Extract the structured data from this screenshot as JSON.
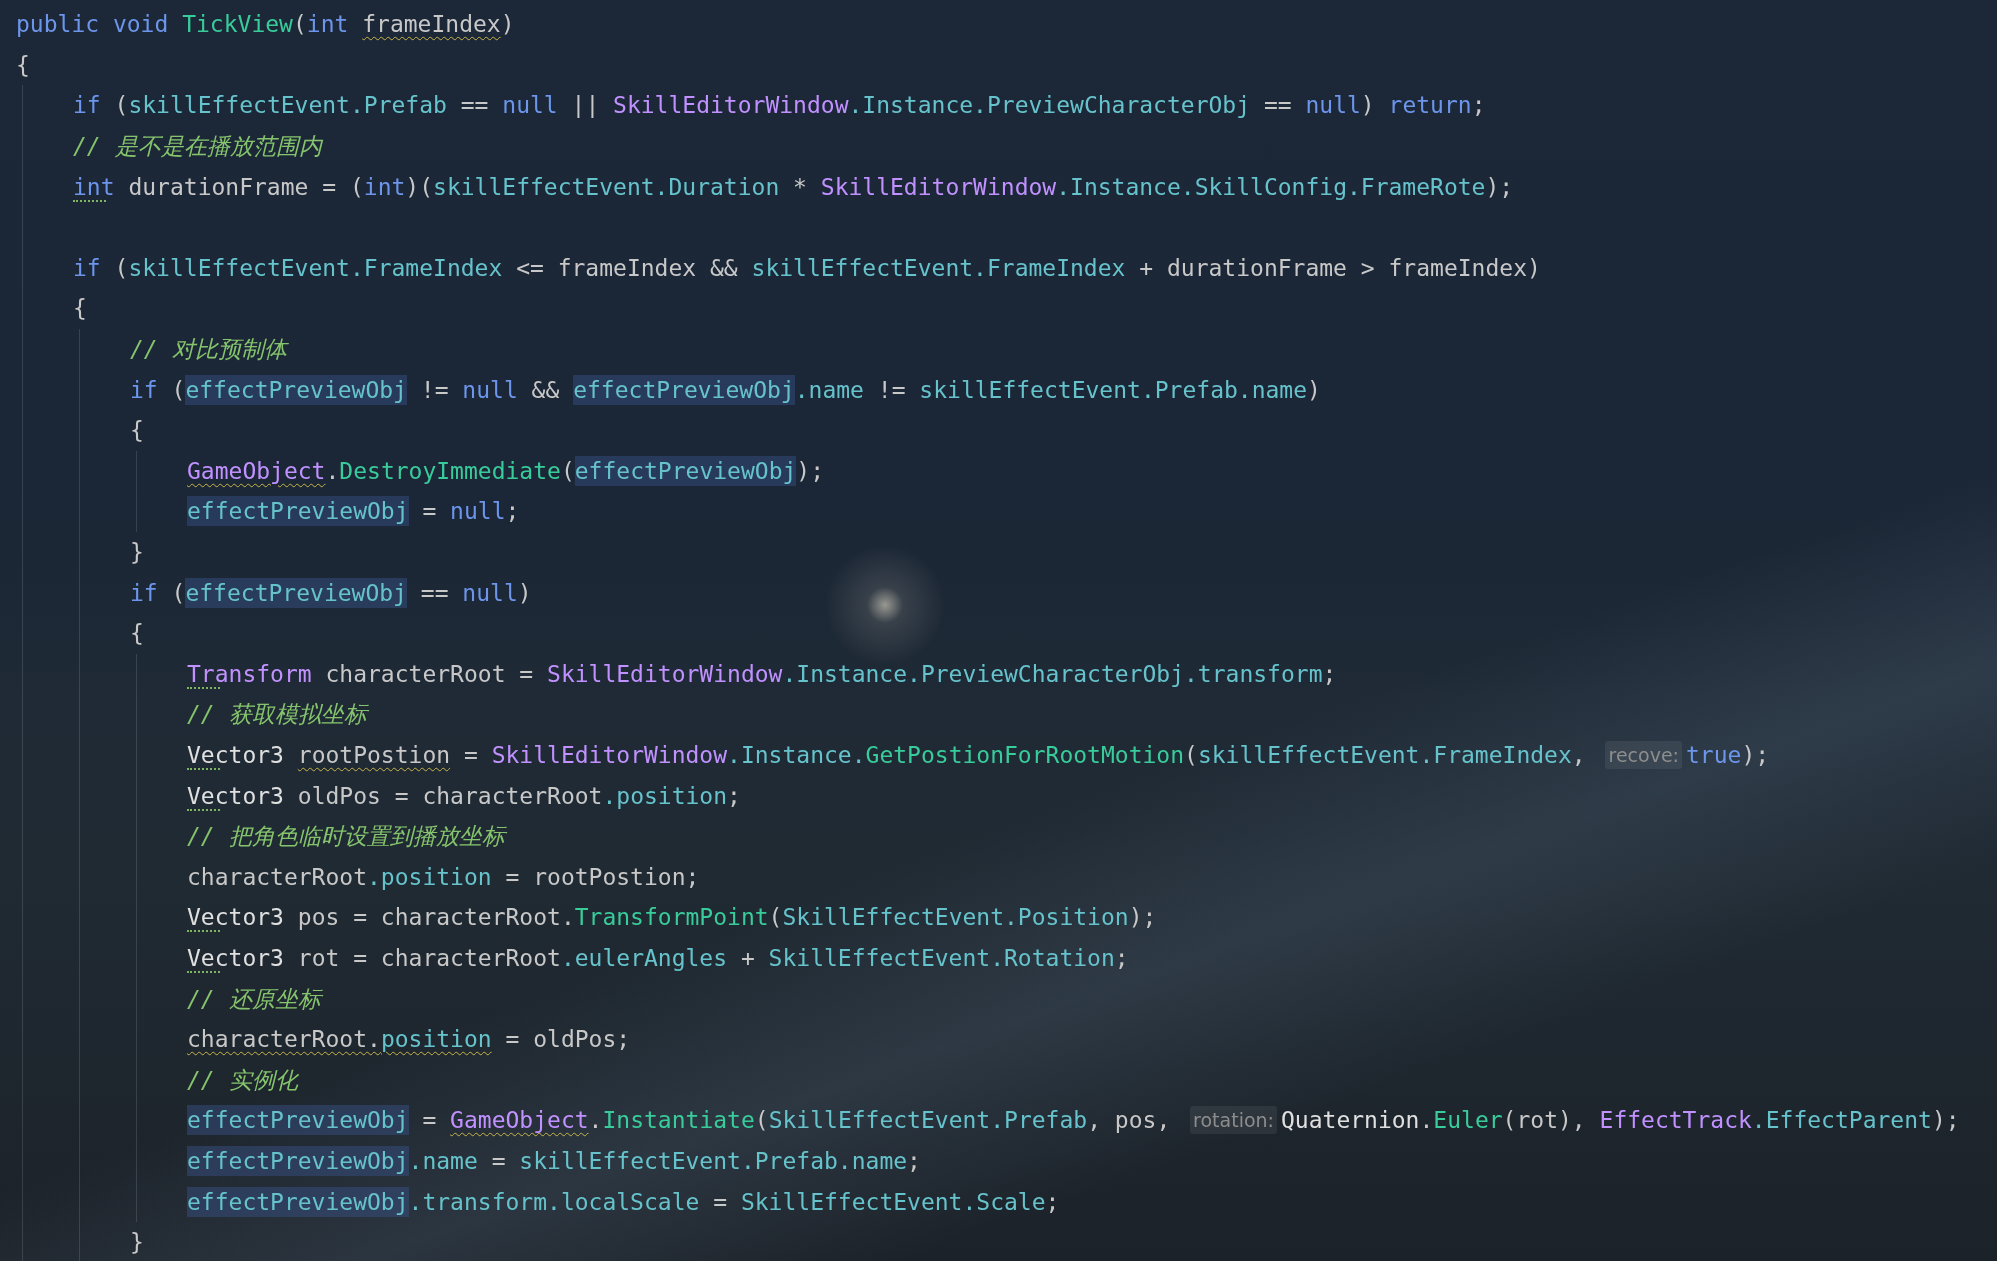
{
  "editor": {
    "lines": [
      {
        "tokens": [
          {
            "text": "public void ",
            "kind": "keyword",
            "wavy": false,
            "dotted": false,
            "highlighted": false
          },
          {
            "text": "TickView",
            "kind": "method",
            "wavy": false,
            "dotted": false,
            "highlighted": false
          },
          {
            "text": "(",
            "kind": "plain",
            "wavy": false,
            "dotted": false,
            "highlighted": false
          },
          {
            "text": "int ",
            "kind": "keyword",
            "wavy": false,
            "dotted": false,
            "highlighted": false
          },
          {
            "text": "frameIndex",
            "kind": "plain",
            "wavy": true,
            "dotted": false,
            "highlighted": false
          },
          {
            "text": ")",
            "kind": "plain",
            "wavy": false,
            "dotted": false,
            "highlighted": false
          }
        ]
      },
      {
        "tokens": [
          {
            "text": "{",
            "kind": "plain",
            "wavy": false,
            "dotted": false,
            "highlighted": false
          }
        ],
        "children": [
          {
            "tokens": [
              {
                "text": "if",
                "kind": "keyword",
                "wavy": false,
                "dotted": false,
                "highlighted": false
              },
              {
                "text": " (",
                "kind": "plain",
                "wavy": false,
                "dotted": false,
                "highlighted": false
              },
              {
                "text": "skillEffectEvent.Prefab",
                "kind": "member",
                "wavy": false,
                "dotted": false,
                "highlighted": false
              },
              {
                "text": " == ",
                "kind": "plain",
                "wavy": false,
                "dotted": false,
                "highlighted": false
              },
              {
                "text": "null",
                "kind": "keyword",
                "wavy": false,
                "dotted": false,
                "highlighted": false
              },
              {
                "text": " || ",
                "kind": "plain",
                "wavy": false,
                "dotted": false,
                "highlighted": false
              },
              {
                "text": "SkillEditorWindow",
                "kind": "class",
                "wavy": false,
                "dotted": false,
                "highlighted": false
              },
              {
                "text": ".Instance.PreviewCharacterObj",
                "kind": "member",
                "wavy": false,
                "dotted": false,
                "highlighted": false
              },
              {
                "text": " == ",
                "kind": "plain",
                "wavy": false,
                "dotted": false,
                "highlighted": false
              },
              {
                "text": "null",
                "kind": "keyword",
                "wavy": false,
                "dotted": false,
                "highlighted": false
              },
              {
                "text": ") ",
                "kind": "plain",
                "wavy": false,
                "dotted": false,
                "highlighted": false
              },
              {
                "text": "return",
                "kind": "keyword",
                "wavy": false,
                "dotted": false,
                "highlighted": false
              },
              {
                "text": ";",
                "kind": "plain",
                "wavy": false,
                "dotted": false,
                "highlighted": false
              }
            ]
          },
          {
            "tokens": [
              {
                "text": "// 是不是在播放范围内",
                "kind": "comment",
                "wavy": false,
                "dotted": false,
                "highlighted": false
              }
            ]
          },
          {
            "tokens": [
              {
                "text": "int",
                "kind": "keyword",
                "wavy": false,
                "dotted": true,
                "highlighted": false
              },
              {
                "text": " durationFrame = (",
                "kind": "plain",
                "wavy": false,
                "dotted": false,
                "highlighted": false
              },
              {
                "text": "int",
                "kind": "keyword",
                "wavy": false,
                "dotted": false,
                "highlighted": false
              },
              {
                "text": ")(",
                "kind": "plain",
                "wavy": false,
                "dotted": false,
                "highlighted": false
              },
              {
                "text": "skillEffectEvent.Duration",
                "kind": "member",
                "wavy": false,
                "dotted": false,
                "highlighted": false
              },
              {
                "text": " * ",
                "kind": "plain",
                "wavy": false,
                "dotted": false,
                "highlighted": false
              },
              {
                "text": "SkillEditorWindow",
                "kind": "class",
                "wavy": false,
                "dotted": false,
                "highlighted": false
              },
              {
                "text": ".Instance.SkillConfig.FrameRote",
                "kind": "member",
                "wavy": false,
                "dotted": false,
                "highlighted": false
              },
              {
                "text": ");",
                "kind": "plain",
                "wavy": false,
                "dotted": false,
                "highlighted": false
              }
            ]
          },
          {
            "blank": true
          },
          {
            "tokens": [
              {
                "text": "if",
                "kind": "keyword",
                "wavy": false,
                "dotted": false,
                "highlighted": false
              },
              {
                "text": " (",
                "kind": "plain",
                "wavy": false,
                "dotted": false,
                "highlighted": false
              },
              {
                "text": "skillEffectEvent.FrameIndex",
                "kind": "member",
                "wavy": false,
                "dotted": false,
                "highlighted": false
              },
              {
                "text": " <= frameIndex && ",
                "kind": "plain",
                "wavy": false,
                "dotted": false,
                "highlighted": false
              },
              {
                "text": "skillEffectEvent.FrameIndex",
                "kind": "member",
                "wavy": false,
                "dotted": false,
                "highlighted": false
              },
              {
                "text": " + durationFrame > frameIndex)",
                "kind": "plain",
                "wavy": false,
                "dotted": false,
                "highlighted": false
              }
            ]
          },
          {
            "tokens": [
              {
                "text": "{",
                "kind": "plain",
                "wavy": false,
                "dotted": false,
                "highlighted": false
              }
            ],
            "children": [
              {
                "tokens": [
                  {
                    "text": "// 对比预制体",
                    "kind": "comment",
                    "wavy": false,
                    "dotted": false,
                    "highlighted": false
                  }
                ]
              },
              {
                "tokens": [
                  {
                    "text": "if",
                    "kind": "keyword",
                    "wavy": false,
                    "dotted": false,
                    "highlighted": false
                  },
                  {
                    "text": " (",
                    "kind": "plain",
                    "wavy": false,
                    "dotted": false,
                    "highlighted": false
                  },
                  {
                    "text": "effectPreviewObj",
                    "kind": "member",
                    "wavy": false,
                    "dotted": false,
                    "highlighted": true
                  },
                  {
                    "text": " != ",
                    "kind": "plain",
                    "wavy": false,
                    "dotted": false,
                    "highlighted": false
                  },
                  {
                    "text": "null",
                    "kind": "keyword",
                    "wavy": false,
                    "dotted": false,
                    "highlighted": false
                  },
                  {
                    "text": " && ",
                    "kind": "plain",
                    "wavy": false,
                    "dotted": false,
                    "highlighted": false
                  },
                  {
                    "text": "effectPreviewObj",
                    "kind": "member",
                    "wavy": false,
                    "dotted": false,
                    "highlighted": true
                  },
                  {
                    "text": ".name",
                    "kind": "member",
                    "wavy": false,
                    "dotted": false,
                    "highlighted": false
                  },
                  {
                    "text": " != ",
                    "kind": "plain",
                    "wavy": false,
                    "dotted": false,
                    "highlighted": false
                  },
                  {
                    "text": "skillEffectEvent.Prefab.name",
                    "kind": "member",
                    "wavy": false,
                    "dotted": false,
                    "highlighted": false
                  },
                  {
                    "text": ")",
                    "kind": "plain",
                    "wavy": false,
                    "dotted": false,
                    "highlighted": false
                  }
                ]
              },
              {
                "tokens": [
                  {
                    "text": "{",
                    "kind": "plain",
                    "wavy": false,
                    "dotted": false,
                    "highlighted": false
                  }
                ],
                "children": [
                  {
                    "tokens": [
                      {
                        "text": "GameObject",
                        "kind": "class",
                        "wavy": true,
                        "dotted": false,
                        "highlighted": false
                      },
                      {
                        "text": ".",
                        "kind": "plain",
                        "wavy": false,
                        "dotted": false,
                        "highlighted": false
                      },
                      {
                        "text": "DestroyImmediate",
                        "kind": "method",
                        "wavy": false,
                        "dotted": false,
                        "highlighted": false
                      },
                      {
                        "text": "(",
                        "kind": "plain",
                        "wavy": false,
                        "dotted": false,
                        "highlighted": false
                      },
                      {
                        "text": "effectPreviewObj",
                        "kind": "member",
                        "wavy": false,
                        "dotted": false,
                        "highlighted": true
                      },
                      {
                        "text": ");",
                        "kind": "plain",
                        "wavy": false,
                        "dotted": false,
                        "highlighted": false
                      }
                    ]
                  },
                  {
                    "tokens": [
                      {
                        "text": "effectPreviewObj",
                        "kind": "member",
                        "wavy": false,
                        "dotted": false,
                        "highlighted": true
                      },
                      {
                        "text": " = ",
                        "kind": "plain",
                        "wavy": false,
                        "dotted": false,
                        "highlighted": false
                      },
                      {
                        "text": "null",
                        "kind": "keyword",
                        "wavy": false,
                        "dotted": false,
                        "highlighted": false
                      },
                      {
                        "text": ";",
                        "kind": "plain",
                        "wavy": false,
                        "dotted": false,
                        "highlighted": false
                      }
                    ]
                  }
                ]
              },
              {
                "tokens": [
                  {
                    "text": "}",
                    "kind": "plain",
                    "wavy": false,
                    "dotted": false,
                    "highlighted": false
                  }
                ]
              },
              {
                "tokens": [
                  {
                    "text": "if",
                    "kind": "keyword",
                    "wavy": false,
                    "dotted": false,
                    "highlighted": false
                  },
                  {
                    "text": " (",
                    "kind": "plain",
                    "wavy": false,
                    "dotted": false,
                    "highlighted": false
                  },
                  {
                    "text": "effectPreviewObj",
                    "kind": "member",
                    "wavy": false,
                    "dotted": false,
                    "highlighted": true
                  },
                  {
                    "text": " == ",
                    "kind": "plain",
                    "wavy": false,
                    "dotted": false,
                    "highlighted": false
                  },
                  {
                    "text": "null",
                    "kind": "keyword",
                    "wavy": false,
                    "dotted": false,
                    "highlighted": false
                  },
                  {
                    "text": ")",
                    "kind": "plain",
                    "wavy": false,
                    "dotted": false,
                    "highlighted": false
                  }
                ]
              },
              {
                "tokens": [
                  {
                    "text": "{",
                    "kind": "plain",
                    "wavy": false,
                    "dotted": false,
                    "highlighted": false
                  }
                ],
                "children": [
                  {
                    "tokens": [
                      {
                        "text": "Transform",
                        "kind": "class",
                        "wavy": false,
                        "dotted": true,
                        "highlighted": false
                      },
                      {
                        "text": " characterRoot = ",
                        "kind": "plain",
                        "wavy": false,
                        "dotted": false,
                        "highlighted": false
                      },
                      {
                        "text": "SkillEditorWindow",
                        "kind": "class",
                        "wavy": false,
                        "dotted": false,
                        "highlighted": false
                      },
                      {
                        "text": ".Instance.PreviewCharacterObj.transform",
                        "kind": "member",
                        "wavy": false,
                        "dotted": false,
                        "highlighted": false
                      },
                      {
                        "text": ";",
                        "kind": "plain",
                        "wavy": false,
                        "dotted": false,
                        "highlighted": false
                      }
                    ]
                  },
                  {
                    "tokens": [
                      {
                        "text": "// 获取模拟坐标",
                        "kind": "comment",
                        "wavy": false,
                        "dotted": false,
                        "highlighted": false
                      }
                    ]
                  },
                  {
                    "tokens": [
                      {
                        "text": "Vector3 ",
                        "kind": "struct",
                        "wavy": false,
                        "dotted": true,
                        "highlighted": false
                      },
                      {
                        "text": "rootPostion",
                        "kind": "plain",
                        "wavy": true,
                        "dotted": false,
                        "highlighted": false
                      },
                      {
                        "text": " = ",
                        "kind": "plain",
                        "wavy": false,
                        "dotted": false,
                        "highlighted": false
                      },
                      {
                        "text": "SkillEditorWindow",
                        "kind": "class",
                        "wavy": false,
                        "dotted": false,
                        "highlighted": false
                      },
                      {
                        "text": ".Instance.",
                        "kind": "member",
                        "wavy": false,
                        "dotted": false,
                        "highlighted": false
                      },
                      {
                        "text": "GetPostionForRootMotion",
                        "kind": "method",
                        "wavy": false,
                        "dotted": false,
                        "highlighted": false
                      },
                      {
                        "text": "(",
                        "kind": "plain",
                        "wavy": false,
                        "dotted": false,
                        "highlighted": false
                      },
                      {
                        "text": "skillEffectEvent.FrameIndex",
                        "kind": "member",
                        "wavy": false,
                        "dotted": false,
                        "highlighted": false
                      },
                      {
                        "text": ", ",
                        "kind": "plain",
                        "wavy": false,
                        "dotted": false,
                        "highlighted": false
                      },
                      {
                        "text": "recove:",
                        "kind": "hint",
                        "wavy": false,
                        "dotted": false,
                        "highlighted": false
                      },
                      {
                        "text": "true",
                        "kind": "keyword",
                        "wavy": false,
                        "dotted": false,
                        "highlighted": false
                      },
                      {
                        "text": ");",
                        "kind": "plain",
                        "wavy": false,
                        "dotted": false,
                        "highlighted": false
                      }
                    ]
                  },
                  {
                    "tokens": [
                      {
                        "text": "Vector3",
                        "kind": "struct",
                        "wavy": false,
                        "dotted": true,
                        "highlighted": false
                      },
                      {
                        "text": " oldPos = characterRoot",
                        "kind": "plain",
                        "wavy": false,
                        "dotted": false,
                        "highlighted": false
                      },
                      {
                        "text": ".position",
                        "kind": "member",
                        "wavy": false,
                        "dotted": false,
                        "highlighted": false
                      },
                      {
                        "text": ";",
                        "kind": "plain",
                        "wavy": false,
                        "dotted": false,
                        "highlighted": false
                      }
                    ]
                  },
                  {
                    "tokens": [
                      {
                        "text": "// 把角色临时设置到播放坐标",
                        "kind": "comment",
                        "wavy": false,
                        "dotted": false,
                        "highlighted": false
                      }
                    ]
                  },
                  {
                    "tokens": [
                      {
                        "text": "characterRoot",
                        "kind": "plain",
                        "wavy": false,
                        "dotted": false,
                        "highlighted": false
                      },
                      {
                        "text": ".position",
                        "kind": "member",
                        "wavy": false,
                        "dotted": false,
                        "highlighted": false
                      },
                      {
                        "text": " = rootPostion;",
                        "kind": "plain",
                        "wavy": false,
                        "dotted": false,
                        "highlighted": false
                      }
                    ]
                  },
                  {
                    "tokens": [
                      {
                        "text": "Vector3",
                        "kind": "struct",
                        "wavy": false,
                        "dotted": true,
                        "highlighted": false
                      },
                      {
                        "text": " pos = characterRoot.",
                        "kind": "plain",
                        "wavy": false,
                        "dotted": false,
                        "highlighted": false
                      },
                      {
                        "text": "TransformPoint",
                        "kind": "method",
                        "wavy": false,
                        "dotted": false,
                        "highlighted": false
                      },
                      {
                        "text": "(",
                        "kind": "plain",
                        "wavy": false,
                        "dotted": false,
                        "highlighted": false
                      },
                      {
                        "text": "SkillEffectEvent.Position",
                        "kind": "member",
                        "wavy": false,
                        "dotted": false,
                        "highlighted": false
                      },
                      {
                        "text": ");",
                        "kind": "plain",
                        "wavy": false,
                        "dotted": false,
                        "highlighted": false
                      }
                    ]
                  },
                  {
                    "tokens": [
                      {
                        "text": "Vector3",
                        "kind": "struct",
                        "wavy": false,
                        "dotted": true,
                        "highlighted": false
                      },
                      {
                        "text": " rot = characterRoot",
                        "kind": "plain",
                        "wavy": false,
                        "dotted": false,
                        "highlighted": false
                      },
                      {
                        "text": ".eulerAngles",
                        "kind": "member",
                        "wavy": false,
                        "dotted": false,
                        "highlighted": false
                      },
                      {
                        "text": " + ",
                        "kind": "plain",
                        "wavy": false,
                        "dotted": false,
                        "highlighted": false
                      },
                      {
                        "text": "SkillEffectEvent.Rotation",
                        "kind": "member",
                        "wavy": false,
                        "dotted": false,
                        "highlighted": false
                      },
                      {
                        "text": ";",
                        "kind": "plain",
                        "wavy": false,
                        "dotted": false,
                        "highlighted": false
                      }
                    ]
                  },
                  {
                    "tokens": [
                      {
                        "text": "// 还原坐标",
                        "kind": "comment",
                        "wavy": false,
                        "dotted": false,
                        "highlighted": false
                      }
                    ]
                  },
                  {
                    "tokens": [
                      {
                        "text": "characterRoot.",
                        "kind": "plain",
                        "wavy": true,
                        "dotted": false,
                        "highlighted": false
                      },
                      {
                        "text": "position",
                        "kind": "member",
                        "wavy": true,
                        "dotted": false,
                        "highlighted": false
                      },
                      {
                        "text": " = oldPos;",
                        "kind": "plain",
                        "wavy": false,
                        "dotted": false,
                        "highlighted": false
                      }
                    ]
                  },
                  {
                    "tokens": [
                      {
                        "text": "// 实例化",
                        "kind": "comment",
                        "wavy": false,
                        "dotted": false,
                        "highlighted": false
                      }
                    ]
                  },
                  {
                    "tokens": [
                      {
                        "text": "effectPreviewObj",
                        "kind": "member",
                        "wavy": false,
                        "dotted": false,
                        "highlighted": true
                      },
                      {
                        "text": " = ",
                        "kind": "plain",
                        "wavy": false,
                        "dotted": false,
                        "highlighted": false
                      },
                      {
                        "text": "GameObject",
                        "kind": "class",
                        "wavy": true,
                        "dotted": false,
                        "highlighted": false
                      },
                      {
                        "text": ".",
                        "kind": "plain",
                        "wavy": false,
                        "dotted": false,
                        "highlighted": false
                      },
                      {
                        "text": "Instantiate",
                        "kind": "method",
                        "wavy": false,
                        "dotted": false,
                        "highlighted": false
                      },
                      {
                        "text": "(",
                        "kind": "plain",
                        "wavy": false,
                        "dotted": false,
                        "highlighted": false
                      },
                      {
                        "text": "SkillEffectEvent.Prefab",
                        "kind": "member",
                        "wavy": false,
                        "dotted": false,
                        "highlighted": false
                      },
                      {
                        "text": ", pos, ",
                        "kind": "plain",
                        "wavy": false,
                        "dotted": false,
                        "highlighted": false
                      },
                      {
                        "text": "rotation:",
                        "kind": "hint",
                        "wavy": false,
                        "dotted": false,
                        "highlighted": false
                      },
                      {
                        "text": "Quaternion",
                        "kind": "struct",
                        "wavy": false,
                        "dotted": false,
                        "highlighted": false
                      },
                      {
                        "text": ".",
                        "kind": "plain",
                        "wavy": false,
                        "dotted": false,
                        "highlighted": false
                      },
                      {
                        "text": "Euler",
                        "kind": "method",
                        "wavy": false,
                        "dotted": false,
                        "highlighted": false
                      },
                      {
                        "text": "(rot), ",
                        "kind": "plain",
                        "wavy": false,
                        "dotted": false,
                        "highlighted": false
                      },
                      {
                        "text": "EffectTrack",
                        "kind": "class",
                        "wavy": false,
                        "dotted": false,
                        "highlighted": false
                      },
                      {
                        "text": ".EffectParent",
                        "kind": "member",
                        "wavy": false,
                        "dotted": false,
                        "highlighted": false
                      },
                      {
                        "text": ");",
                        "kind": "plain",
                        "wavy": false,
                        "dotted": false,
                        "highlighted": false
                      }
                    ]
                  },
                  {
                    "tokens": [
                      {
                        "text": "effectPreviewObj",
                        "kind": "member",
                        "wavy": false,
                        "dotted": false,
                        "highlighted": true
                      },
                      {
                        "text": ".name",
                        "kind": "member",
                        "wavy": false,
                        "dotted": false,
                        "highlighted": false
                      },
                      {
                        "text": " = ",
                        "kind": "plain",
                        "wavy": false,
                        "dotted": false,
                        "highlighted": false
                      },
                      {
                        "text": "skillEffectEvent.Prefab.name",
                        "kind": "member",
                        "wavy": false,
                        "dotted": false,
                        "highlighted": false
                      },
                      {
                        "text": ";",
                        "kind": "plain",
                        "wavy": false,
                        "dotted": false,
                        "highlighted": false
                      }
                    ]
                  },
                  {
                    "tokens": [
                      {
                        "text": "effectPreviewObj",
                        "kind": "member",
                        "wavy": false,
                        "dotted": false,
                        "highlighted": true
                      },
                      {
                        "text": ".transform.localScale",
                        "kind": "member",
                        "wavy": false,
                        "dotted": false,
                        "highlighted": false
                      },
                      {
                        "text": " = ",
                        "kind": "plain",
                        "wavy": false,
                        "dotted": false,
                        "highlighted": false
                      },
                      {
                        "text": "SkillEffectEvent.Scale",
                        "kind": "member",
                        "wavy": false,
                        "dotted": false,
                        "highlighted": false
                      },
                      {
                        "text": ";",
                        "kind": "plain",
                        "wavy": false,
                        "dotted": false,
                        "highlighted": false
                      }
                    ]
                  }
                ]
              },
              {
                "tokens": [
                  {
                    "text": "}",
                    "kind": "plain",
                    "wavy": false,
                    "dotted": false,
                    "highlighted": false
                  }
                ]
              }
            ]
          }
        ]
      }
    ]
  }
}
